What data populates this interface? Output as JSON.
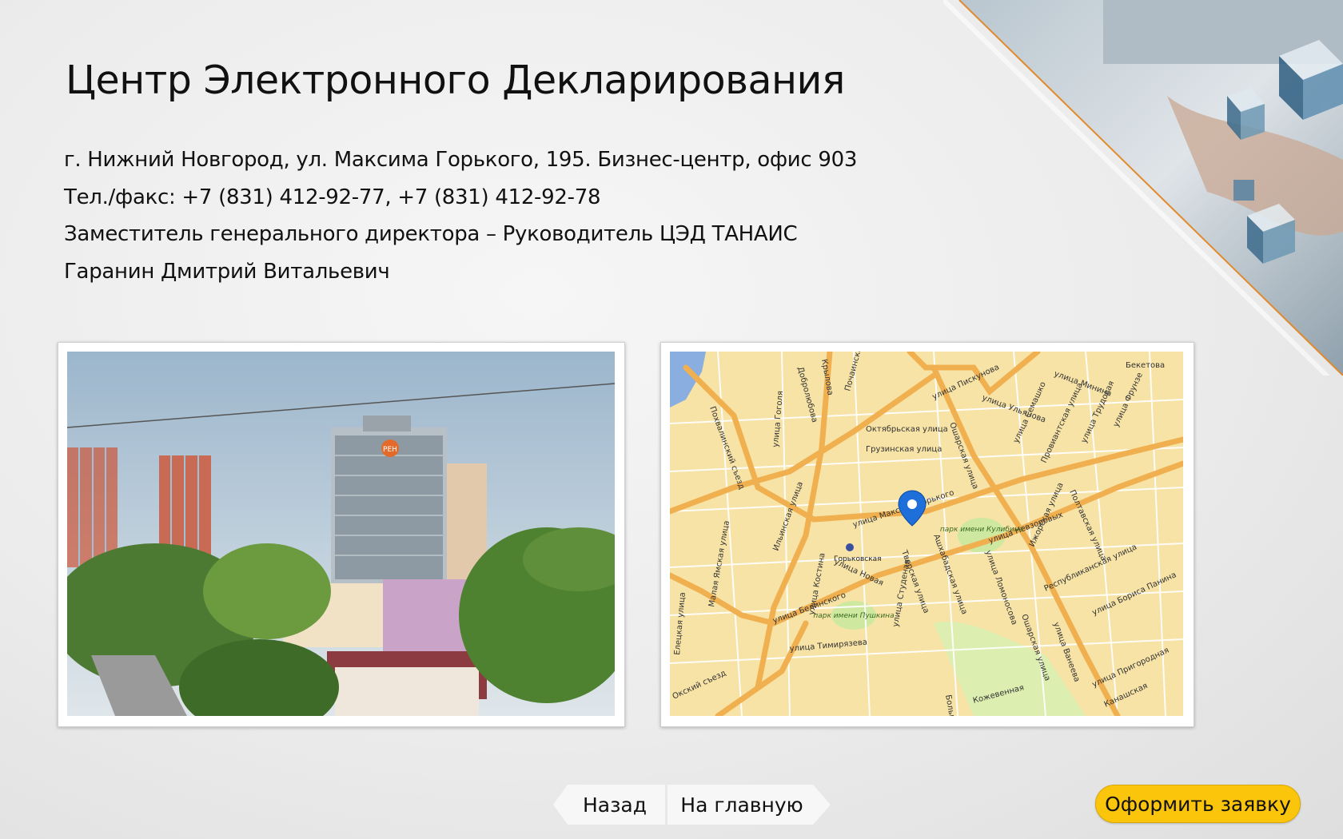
{
  "page": {
    "title": "Центр Электронного Декларирования",
    "address": "г. Нижний Новгород, ул. Максима Горького, 195. Бизнес-центр, офис 903",
    "phone": "Тел./факс: +7 (831) 412-92-77, +7 (831) 412-92-78",
    "position": "Заместитель генерального директора – Руководитель ЦЭД ТАНАИС",
    "person": "Гаранин Дмитрий Витальевич"
  },
  "photo": {
    "sign": "РЕН"
  },
  "map": {
    "streets": [
      "улица Максима Горького",
      "улица Пискунова",
      "улица Минина",
      "улица Ульянова",
      "Октябрьская улица",
      "Грузинская улица",
      "Ошарская улица",
      "улица Семашко",
      "Провиантская улица",
      "улица Трудовая",
      "улица Фрунзе",
      "Ильинская улица",
      "Похвалинский съезд",
      "улица Гоголя",
      "улица Костина",
      "улица Новая",
      "улица Студеная",
      "Тверская улица",
      "Ашхабадская улица",
      "улица Ломоносова",
      "улица Невзоровых",
      "Ижорская улица",
      "Полтавская улица",
      "Республиканская улица",
      "улица Бориса Панина",
      "улица Белинского",
      "улица Тимирязева",
      "Малая Ямская улица",
      "Елецкая улица",
      "Окский съезд",
      "Ошарская улица",
      "улица Ванеева",
      "улица Пригородная",
      "Канашская",
      "Бекетова",
      "Почаинская",
      "Добролюбова",
      "Большая Покровская",
      "Кожевенная",
      "Крылова"
    ],
    "park_kulibina": "парк имени Кулибина",
    "park_pushkina": "парк имени Пушкина",
    "metro": "Горьковская"
  },
  "nav": {
    "back": "Назад",
    "home": "На главную",
    "apply": "Оформить заявку"
  },
  "colors": {
    "accent": "#fbc50c",
    "map_road": "#f0b050",
    "map_background": "#f7e3a6",
    "corner_line": "#e08a2c"
  }
}
